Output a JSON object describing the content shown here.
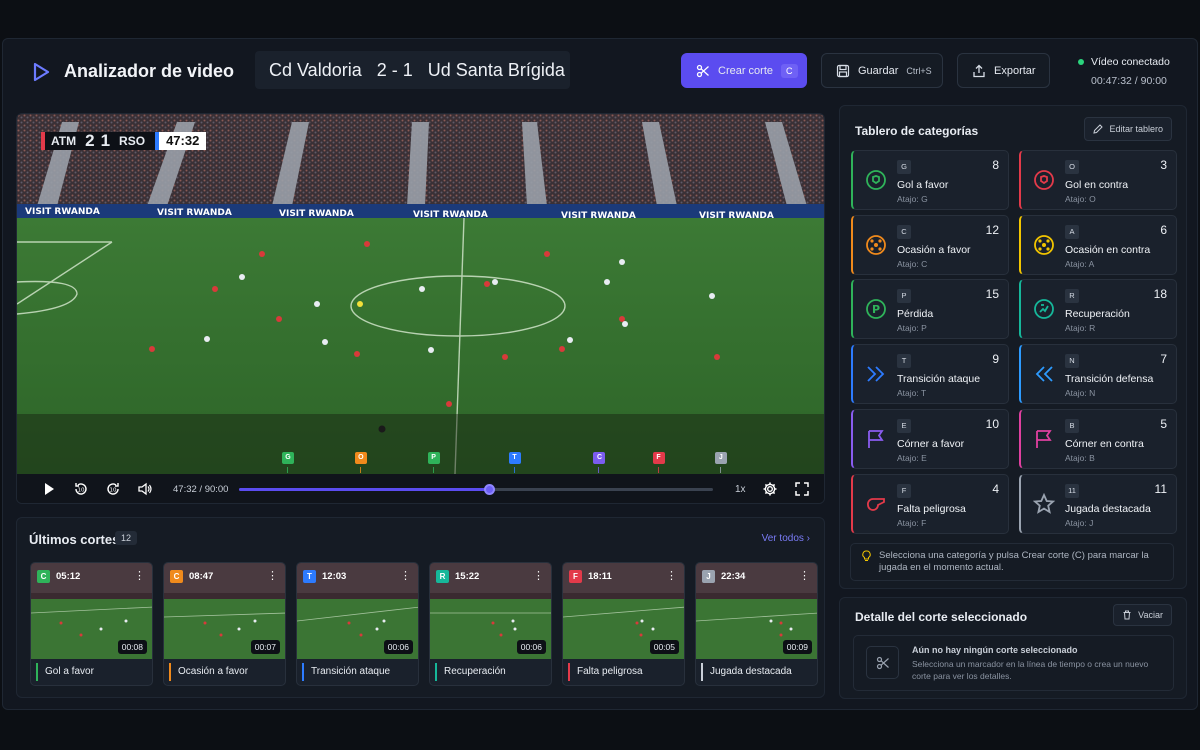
{
  "app": {
    "title": "Analizador de video"
  },
  "match": {
    "home": "Cd Valdoria",
    "score": "2 - 1",
    "away": "Ud Santa Brígida"
  },
  "toolbar": {
    "create_label": "Crear corte",
    "create_key": "C",
    "save_label": "Guardar",
    "save_key": "Ctrl+S",
    "export_label": "Exportar"
  },
  "status": {
    "label": "Vídeo conectado",
    "time": "00:47:32 / 90:00",
    "color": "#2bd47d"
  },
  "video": {
    "scorebug": {
      "home": "ATM",
      "home_score": "2",
      "away_score": "1",
      "away": "RSO",
      "clock": "47:32"
    },
    "ad_text": "VISIT RWANDA",
    "time_display": "47:32 / 90:00",
    "progress": 0.5281,
    "speed": "1x",
    "markers": [
      {
        "key": "G",
        "color": "#2fb35a",
        "pos": 0.335
      },
      {
        "key": "O",
        "color": "#f08a1c",
        "pos": 0.425
      },
      {
        "key": "P",
        "color": "#2fb35a",
        "pos": 0.515
      },
      {
        "key": "T",
        "color": "#2d7bff",
        "pos": 0.615
      },
      {
        "key": "C",
        "color": "#7b5cf0",
        "pos": 0.72
      },
      {
        "key": "F",
        "color": "#e33a4a",
        "pos": 0.793
      },
      {
        "key": "J",
        "color": "#9aa3b0",
        "pos": 0.87
      }
    ]
  },
  "recent": {
    "title": "Últimos cortes",
    "count": "12",
    "see_all": "Ver todos",
    "cuts": [
      {
        "key": "C",
        "color": "#2fb35a",
        "time": "05:12",
        "duration": "00:08",
        "label": "Gol a favor",
        "label_color": "#2fb35a"
      },
      {
        "key": "C",
        "color": "#f08a1c",
        "time": "08:47",
        "duration": "00:07",
        "label": "Ocasión a favor",
        "label_color": "#f08a1c"
      },
      {
        "key": "T",
        "color": "#2d7bff",
        "time": "12:03",
        "duration": "00:06",
        "label": "Transición ataque",
        "label_color": "#2d7bff"
      },
      {
        "key": "R",
        "color": "#16b79a",
        "time": "15:22",
        "duration": "00:06",
        "label": "Recuperación",
        "label_color": "#16b79a"
      },
      {
        "key": "F",
        "color": "#e33a4a",
        "time": "18:11",
        "duration": "00:05",
        "label": "Falta peligrosa",
        "label_color": "#e33a4a"
      },
      {
        "key": "J",
        "color": "#9aa3b0",
        "time": "22:34",
        "duration": "00:09",
        "label": "Jugada destacada",
        "label_color": "#c9cfd8"
      }
    ]
  },
  "board": {
    "title": "Tablero de categorías",
    "edit_label": "Editar tablero",
    "categories": [
      {
        "key": "G",
        "name": "Gol a favor",
        "shortcut": "Atajo: G",
        "count": "8",
        "color": "#2fb35a",
        "icon": "ball-icon"
      },
      {
        "key": "O",
        "name": "Gol en contra",
        "shortcut": "Atajo: O",
        "count": "3",
        "color": "#e33a4a",
        "icon": "ball-icon"
      },
      {
        "key": "C",
        "name": "Ocasión a favor",
        "shortcut": "Atajo: C",
        "count": "12",
        "color": "#f08a1c",
        "icon": "target-icon"
      },
      {
        "key": "A",
        "name": "Ocasión en contra",
        "shortcut": "Atajo: A",
        "count": "6",
        "color": "#f2c500",
        "icon": "target-icon"
      },
      {
        "key": "P",
        "name": "Pérdida",
        "shortcut": "Atajo: P",
        "count": "15",
        "color": "#2fb35a",
        "icon": "loss-icon"
      },
      {
        "key": "R",
        "name": "Recuperación",
        "shortcut": "Atajo: R",
        "count": "18",
        "color": "#16b79a",
        "icon": "recover-icon"
      },
      {
        "key": "T",
        "name": "Transición ataque",
        "shortcut": "Atajo: T",
        "count": "9",
        "color": "#2d7bff",
        "icon": "forward-icon"
      },
      {
        "key": "N",
        "name": "Transición defensa",
        "shortcut": "Atajo: N",
        "count": "7",
        "color": "#2d9bff",
        "icon": "backward-icon"
      },
      {
        "key": "E",
        "name": "Córner a favor",
        "shortcut": "Atajo: E",
        "count": "10",
        "color": "#8a5cf0",
        "icon": "flag-icon"
      },
      {
        "key": "B",
        "name": "Córner en contra",
        "shortcut": "Atajo: B",
        "count": "5",
        "color": "#e040a0",
        "icon": "flag-icon"
      },
      {
        "key": "F",
        "name": "Falta peligrosa",
        "shortcut": "Atajo: F",
        "count": "4",
        "color": "#e33a4a",
        "icon": "whistle-icon"
      },
      {
        "key": "11",
        "name": "Jugada destacada",
        "shortcut": "Atajo: J",
        "count": "11",
        "color": "#9aa3b0",
        "icon": "star-icon"
      }
    ],
    "hint": "Selecciona una categoría y pulsa Crear corte (C) para marcar la jugada en el momento actual."
  },
  "detail": {
    "title": "Detalle del corte seleccionado",
    "clear_label": "Vaciar",
    "empty_title": "Aún no hay ningún corte seleccionado",
    "empty_desc": "Selecciona un marcador en la línea de tiempo o crea un nuevo corte para ver los detalles."
  }
}
